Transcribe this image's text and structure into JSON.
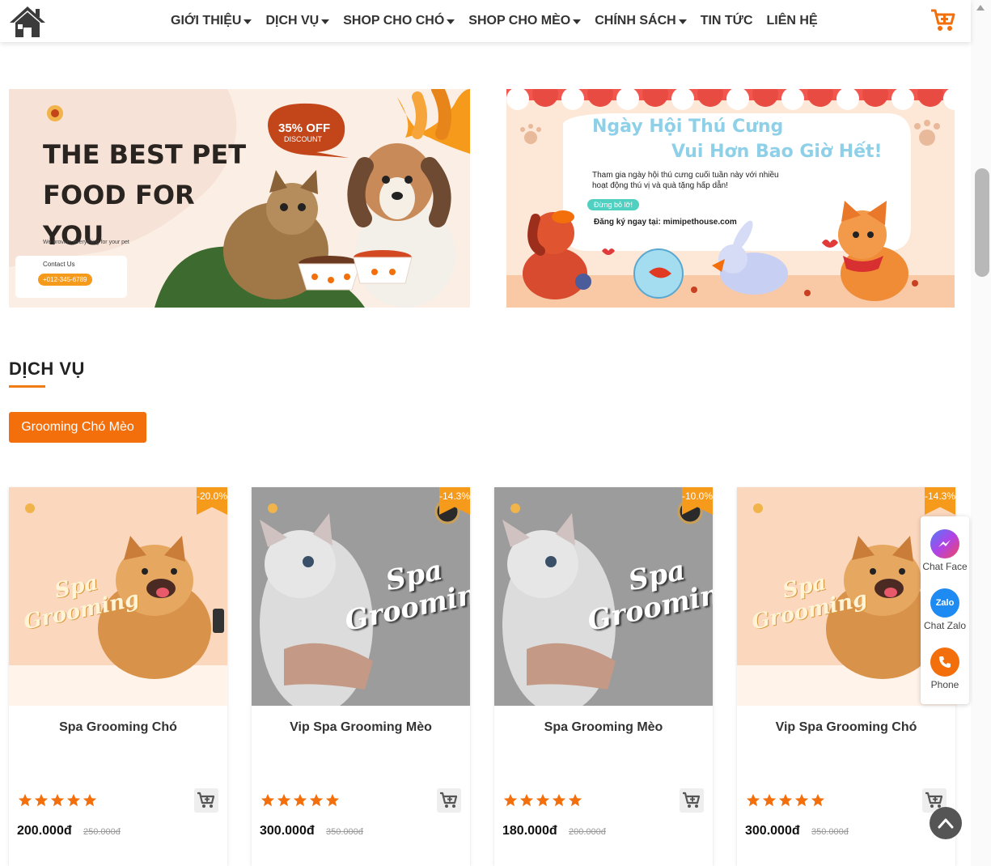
{
  "nav": {
    "items": [
      {
        "label": "GIỚI THIỆU",
        "has_caret": true
      },
      {
        "label": "DỊCH VỤ",
        "has_caret": true
      },
      {
        "label": "SHOP CHO CHÓ",
        "has_caret": true
      },
      {
        "label": "SHOP CHO MÈO",
        "has_caret": true
      },
      {
        "label": "CHÍNH SÁCH",
        "has_caret": true
      },
      {
        "label": "TIN TỨC",
        "has_caret": false
      },
      {
        "label": "LIÊN HỆ",
        "has_caret": false
      }
    ]
  },
  "banner_left": {
    "headline_1": "THE BEST PET",
    "headline_2": "FOOD FOR",
    "headline_3": "YOU",
    "tagline": "We provide everything for your pet",
    "bubble_main": "35% OFF",
    "bubble_sub": "DISCOUNT",
    "contact_label": "Contact Us",
    "contact_phone": "+012-345-6789"
  },
  "banner_right": {
    "title_1": "Ngày Hội Thú Cưng",
    "title_2": "Vui Hơn Bao Giờ Hết!",
    "body_1": "Tham gia ngày hội thú cưng cuối tuần này với nhiều",
    "body_2": "hoạt động thú vị và quà tặng hấp dẫn!",
    "pill": "Đừng bỏ lỡ!",
    "register": "Đăng ký ngay tại: mimipethouse.com"
  },
  "section": {
    "title": "DỊCH VỤ",
    "filter": "Grooming Chó Mèo"
  },
  "products": [
    {
      "name": "Spa Grooming Chó",
      "badge": "-20.0%",
      "price": "200.000đ",
      "old_price": "250.000đ",
      "rating": 5,
      "image": "dog"
    },
    {
      "name": "Vip Spa Grooming Mèo",
      "badge": "-14.3%",
      "price": "300.000đ",
      "old_price": "350.000đ",
      "rating": 5,
      "image": "cat"
    },
    {
      "name": "Spa Grooming Mèo",
      "badge": "-10.0%",
      "price": "180.000đ",
      "old_price": "200.000đ",
      "rating": 5,
      "image": "cat"
    },
    {
      "name": "Vip Spa Grooming Chó",
      "badge": "-14.3%",
      "price": "300.000đ",
      "old_price": "350.000đ",
      "rating": 5,
      "image": "dog"
    }
  ],
  "spa_text_1": "Spa",
  "spa_text_2": "Grooming",
  "contact": {
    "messenger": "Chat Face",
    "zalo": "Chat Zalo",
    "zalo_icon": "Zalo",
    "phone": "Phone"
  },
  "colors": {
    "accent": "#f36f0c",
    "badge": "#f59a1a",
    "star": "#f36f0c"
  },
  "icons": {
    "home": "home-icon",
    "cart": "cart-plus-icon",
    "messenger": "messenger-icon",
    "zalo": "zalo-icon",
    "phone": "phone-icon",
    "back_top": "chevron-up-icon"
  }
}
